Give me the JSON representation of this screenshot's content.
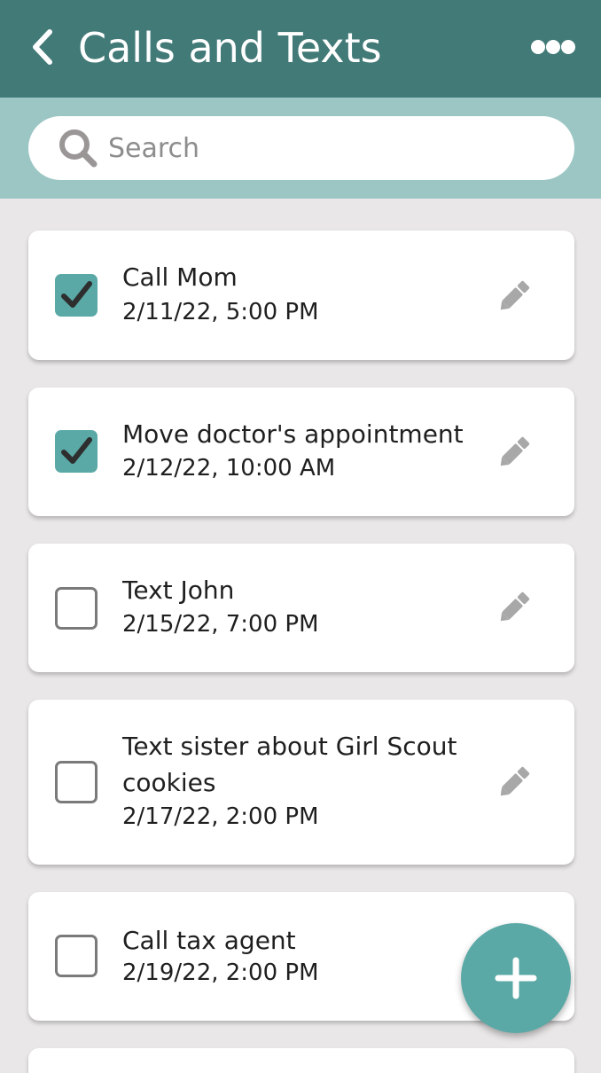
{
  "header": {
    "title": "Calls and Texts",
    "back_icon": "chevron-left-icon",
    "more_icon": "more-horizontal-icon"
  },
  "search": {
    "placeholder": "Search",
    "value": "",
    "icon": "search-icon"
  },
  "tasks": [
    {
      "title": "Call Mom",
      "date": "2/11/22, 5:00 PM",
      "checked": true
    },
    {
      "title": "Move doctor's appointment",
      "date": "2/12/22, 10:00 AM",
      "checked": true
    },
    {
      "title": "Text John",
      "date": "2/15/22, 7:00 PM",
      "checked": false
    },
    {
      "title": "Text sister about Girl Scout cookies",
      "date": "2/17/22, 2:00 PM",
      "checked": false
    },
    {
      "title": "Call tax agent",
      "date": "2/19/22, 2:00 PM",
      "checked": false
    }
  ],
  "fab": {
    "icon": "plus-icon"
  },
  "colors": {
    "header": "#427a77",
    "search_band": "#9cc6c4",
    "accent": "#5aa9a6",
    "background": "#e9e7e7"
  }
}
